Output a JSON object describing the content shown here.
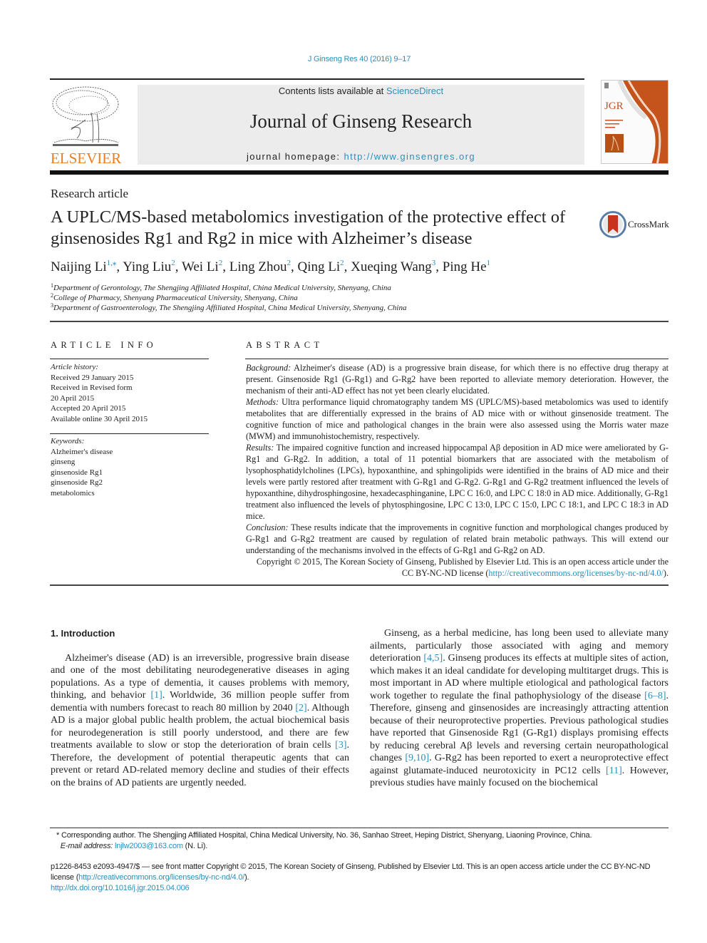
{
  "header": {
    "citation": "J Ginseng Res 40 (2016) 9–17",
    "contents_prefix": "Contents lists available at ",
    "contents_link": "ScienceDirect",
    "journal_title": "Journal of Ginseng Research",
    "homepage_prefix": "journal homepage: ",
    "homepage_url": "http://www.ginsengres.org",
    "publisher_logo": "ELSEVIER",
    "cover_label": "JGR",
    "crossmark_label": "CrossMark"
  },
  "colors": {
    "link": "#2a8fbd",
    "elsevier_orange": "#ee7d1f",
    "band_gray": "#ececec",
    "cover_orange": "#c4541c"
  },
  "article": {
    "type": "Research article",
    "title": "A UPLC/MS-based metabolomics investigation of the protective effect of ginsenosides Rg1 and Rg2 in mice with Alzheimer’s disease",
    "authors": [
      {
        "name": "Naijing Li",
        "sup": "1,⁎"
      },
      {
        "name": "Ying Liu",
        "sup": "2"
      },
      {
        "name": "Wei Li",
        "sup": "2"
      },
      {
        "name": "Ling Zhou",
        "sup": "2"
      },
      {
        "name": "Qing Li",
        "sup": "2"
      },
      {
        "name": "Xueqing Wang",
        "sup": "3"
      },
      {
        "name": "Ping He",
        "sup": "1"
      }
    ],
    "affiliations": [
      {
        "num": "1",
        "text": "Department of Gerontology, The Shengjing Affiliated Hospital, China Medical University, Shenyang, China"
      },
      {
        "num": "2",
        "text": "College of Pharmacy, Shenyang Pharmaceutical University, Shenyang, China"
      },
      {
        "num": "3",
        "text": "Department of Gastroenterology, The Shengjing Affiliated Hospital, China Medical University, Shenyang, China"
      }
    ]
  },
  "article_info": {
    "heading": "ARTICLE INFO",
    "history_label": "Article history:",
    "history": [
      "Received 29 January 2015",
      "Received in Revised form",
      "20 April 2015",
      "Accepted 20 April 2015",
      "Available online 30 April 2015"
    ],
    "keywords_label": "Keywords:",
    "keywords": [
      "Alzheimer's disease",
      "ginseng",
      "ginsenoside Rg1",
      "ginsenoside Rg2",
      "metabolomics"
    ]
  },
  "abstract": {
    "heading": "ABSTRACT",
    "background_label": "Background:",
    "background": " Alzheimer's disease (AD) is a progressive brain disease, for which there is no effective drug therapy at present. Ginsenoside Rg1 (G-Rg1) and G-Rg2 have been reported to alleviate memory deterioration. However, the mechanism of their anti-AD effect has not yet been clearly elucidated.",
    "methods_label": "Methods:",
    "methods": " Ultra performance liquid chromatography tandem MS (UPLC/MS)-based metabolomics was used to identify metabolites that are differentially expressed in the brains of AD mice with or without ginsenoside treatment. The cognitive function of mice and pathological changes in the brain were also assessed using the Morris water maze (MWM) and immunohistochemistry, respectively.",
    "results_label": "Results:",
    "results": " The impaired cognitive function and increased hippocampal Aβ deposition in AD mice were ameliorated by G-Rg1 and G-Rg2. In addition, a total of 11 potential biomarkers that are associated with the metabolism of lysophosphatidylcholines (LPCs), hypoxanthine, and sphingolipids were identified in the brains of AD mice and their levels were partly restored after treatment with G-Rg1 and G-Rg2. G-Rg1 and G-Rg2 treatment influenced the levels of hypoxanthine, dihydrosphingosine, hexadecasphinganine, LPC C 16:0, and LPC C 18:0 in AD mice. Additionally, G-Rg1 treatment also influenced the levels of phytosphingosine, LPC C 13:0, LPC C 15:0, LPC C 18:1, and LPC C 18:3 in AD mice.",
    "conclusion_label": "Conclusion:",
    "conclusion": " These results indicate that the improvements in cognitive function and morphological changes produced by G-Rg1 and G-Rg2 treatment are caused by regulation of related brain metabolic pathways. This will extend our understanding of the mechanisms involved in the effects of G-Rg1 and G-Rg2 on AD.",
    "copyright": "Copyright © 2015, The Korean Society of Ginseng, Published by Elsevier Ltd. This is an open access article under the CC BY-NC-ND license (",
    "license_url": "http://creativecommons.org/licenses/by-nc-nd/4.0/",
    "copyright_end": ")."
  },
  "body": {
    "section_heading": "1.  Introduction",
    "left_para": [
      {
        "t": "Alzheimer's disease (AD) is an irreversible, progressive brain disease and one of the most debilitating neurodegenerative diseases in aging populations. As a type of dementia, it causes problems with memory, thinking, and behavior "
      },
      {
        "ref": "[1]"
      },
      {
        "t": ". Worldwide, 36 million people suffer from dementia with numbers forecast to reach 80 million by 2040 "
      },
      {
        "ref": "[2]"
      },
      {
        "t": ". Although AD is a major global public health problem, the actual biochemical basis for neurodegeneration is still poorly understood, and there are few treatments available to slow or stop the deterioration of brain cells "
      },
      {
        "ref": "[3]"
      },
      {
        "t": ". Therefore, the development of potential therapeutic agents that can prevent or retard AD-related memory decline and studies of their effects on the brains of AD patients are urgently needed."
      }
    ],
    "right_para": [
      {
        "t": "Ginseng, as a herbal medicine, has long been used to alleviate many ailments, particularly those associated with aging and memory deterioration "
      },
      {
        "ref": "[4,5]"
      },
      {
        "t": ". Ginseng produces its effects at multiple sites of action, which makes it an ideal candidate for developing multitarget drugs. This is most important in AD where multiple etiological and pathological factors work together to regulate the final pathophysiology of the disease "
      },
      {
        "ref": "[6–8]"
      },
      {
        "t": ". Therefore, ginseng and ginsenosides are increasingly attracting attention because of their neuroprotective properties. Previous pathological studies have reported that Ginsenoside Rg1 (G-Rg1) displays promising effects by reducing cerebral Aβ levels and reversing certain neuropathological changes "
      },
      {
        "ref": "[9,10]"
      },
      {
        "t": ". G-Rg2 has been reported to exert a neuroprotective effect against glutamate-induced neurotoxicity in PC12 cells "
      },
      {
        "ref": "[11]"
      },
      {
        "t": ". However, previous studies have mainly focused on the biochemical"
      }
    ]
  },
  "footnotes": {
    "corr_mark": "*",
    "corr_text": " Corresponding author. The Shengjing Affiliated Hospital, China Medical University, No. 36, Sanhao Street, Heping District, Shenyang, Liaoning Province, China.",
    "email_label": "E-mail address:",
    "email": "lnjlw2003@163.com",
    "email_suffix": " (N. Li).",
    "issn_text": "p1226-8453 e2093-4947/$ — see front matter Copyright © 2015, The Korean Society of Ginseng, Published by Elsevier Ltd. This is an open access article under the CC BY-NC-ND license (",
    "license_url": "http://creativecommons.org/licenses/by-nc-nd/4.0/",
    "issn_end": ").",
    "doi": "http://dx.doi.org/10.1016/j.jgr.2015.04.006"
  }
}
